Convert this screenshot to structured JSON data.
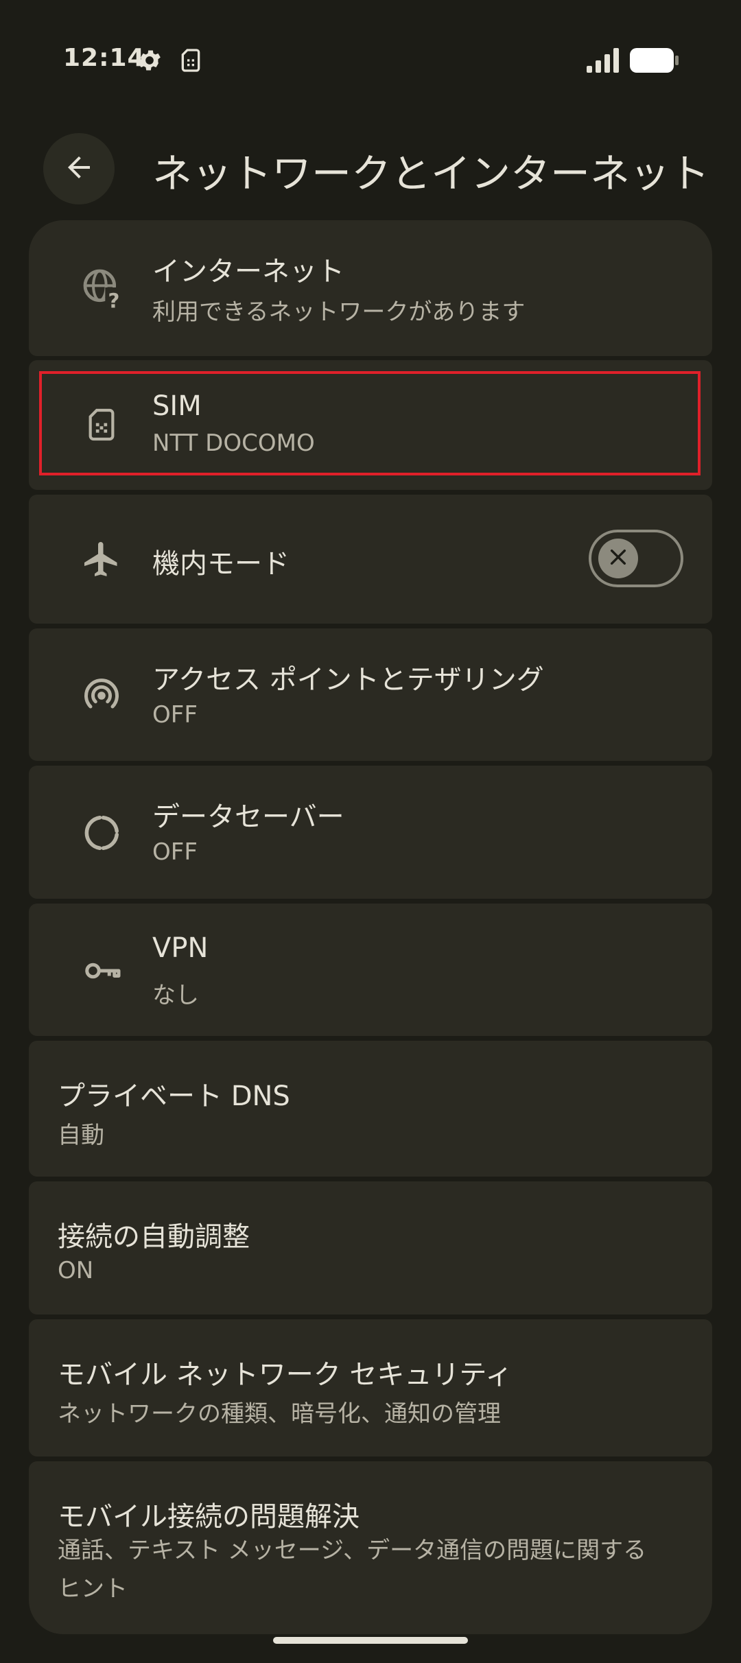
{
  "status_bar": {
    "time": "12:14",
    "icons": [
      "gear-icon",
      "sim-card-icon",
      "signal-icon",
      "battery-icon"
    ]
  },
  "header": {
    "title": "ネットワークとインターネット",
    "back_icon": "arrow-back-icon"
  },
  "items": {
    "internet": {
      "title": "インターネット",
      "subtitle": "利用できるネットワークがあります",
      "icon": "globe-question-icon"
    },
    "sim": {
      "title": "SIM",
      "subtitle": "NTT DOCOMO",
      "icon": "sim-card-icon"
    },
    "airplane": {
      "title": "機内モード",
      "icon": "airplane-icon",
      "toggle_state": "off"
    },
    "hotspot": {
      "title": "アクセス ポイントとテザリング",
      "subtitle": "OFF",
      "icon": "hotspot-icon"
    },
    "data_saver": {
      "title": "データセーバー",
      "subtitle": "OFF",
      "icon": "data-saver-icon"
    },
    "vpn": {
      "title": "VPN",
      "subtitle": "なし",
      "icon": "key-icon"
    },
    "private_dns": {
      "title": "プライベート DNS",
      "subtitle": "自動"
    },
    "adaptive": {
      "title": "接続の自動調整",
      "subtitle": "ON"
    },
    "mobile_security": {
      "title": "モバイル ネットワーク セキュリティ",
      "subtitle": "ネットワークの種類、暗号化、通知の管理"
    },
    "troubleshoot": {
      "title": "モバイル接続の問題解決",
      "subtitle": "通話、テキスト メッセージ、データ通信の問題に関するヒント"
    }
  },
  "colors": {
    "background": "#1c1c16",
    "card": "#2b2a22",
    "text_primary": "#e6e3d8",
    "text_secondary": "#b7b3a5",
    "highlight": "#e0202a"
  }
}
